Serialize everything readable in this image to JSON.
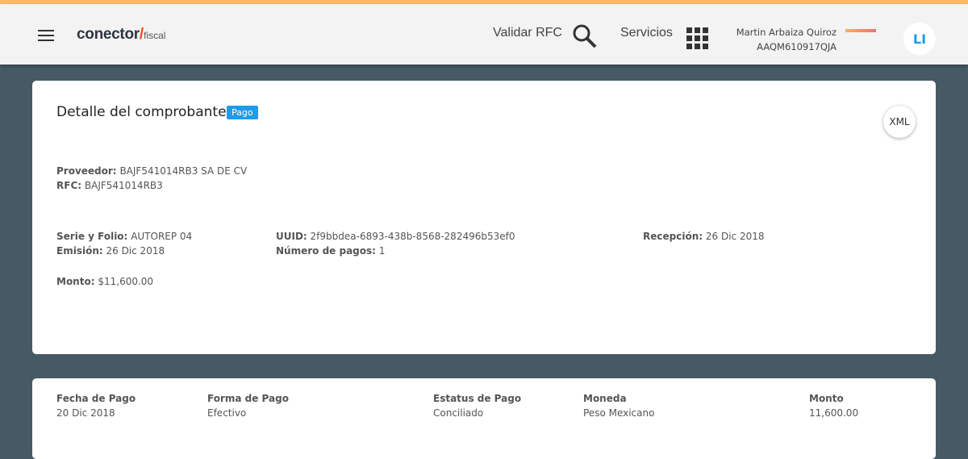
{
  "header": {
    "logo_main": "conector",
    "logo_slash": "/",
    "logo_sub": "fiscal",
    "validar_rfc": "Validar RFC",
    "servicios": "Servicios",
    "user_name": "Martin Arbaiza Quiroz",
    "user_rfc": "AAQM610917QJA",
    "avatar": "LI"
  },
  "detail": {
    "title": "Detalle del comprobante",
    "badge": "Pago",
    "xml": "XML",
    "proveedor_label": "Proveedor:",
    "proveedor": "BAJF541014RB3 SA DE CV",
    "rfc_label": "RFC:",
    "rfc": "BAJF541014RB3",
    "serie_label": "Serie y Folio:",
    "serie": "AUTOREP 04",
    "emision_label": "Emisión:",
    "emision": "26 Dic 2018",
    "uuid_label": "UUID:",
    "uuid": "2f9bbdea-6893-438b-8568-282496b53ef0",
    "npagos_label": "Número de pagos:",
    "npagos": "1",
    "recepcion_label": "Recepción:",
    "recepcion": "26 Dic 2018",
    "monto_label": "Monto:",
    "monto": "$11,600.00"
  },
  "payments": {
    "columns": [
      "Fecha de Pago",
      "Forma de Pago",
      "Estatus de Pago",
      "Moneda",
      "Monto"
    ],
    "row": [
      "20 Dic 2018",
      "Efectivo",
      "Conciliado",
      "Peso Mexicano",
      "11,600.00"
    ]
  }
}
